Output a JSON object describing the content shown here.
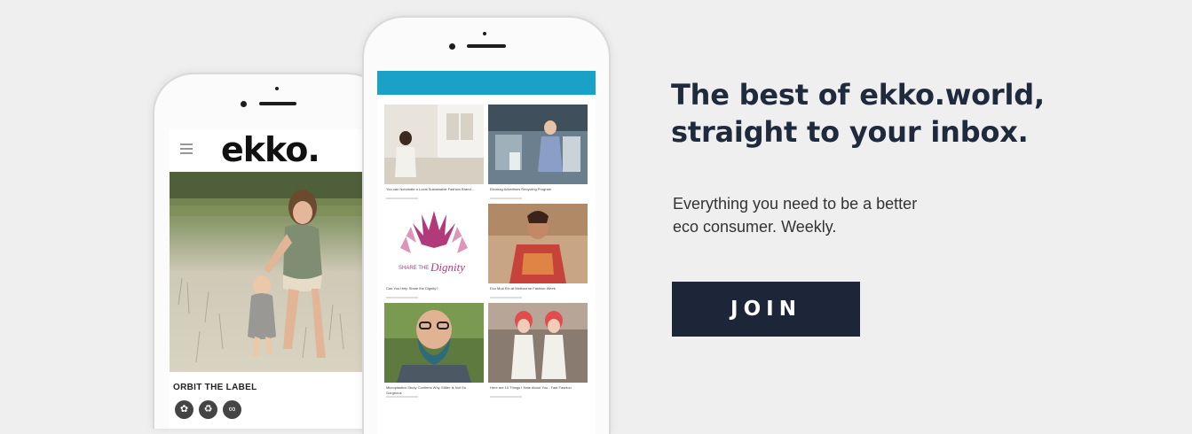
{
  "promo": {
    "headline_line1": "The best of ekko.world,",
    "headline_line2": "straight to your inbox.",
    "subline_line1": "Everything you need to be a better",
    "subline_line2": "eco consumer. Weekly.",
    "join_label": "JOIN"
  },
  "left_phone": {
    "logo": "ekko.",
    "brand_label": "ORBIT THE LABEL",
    "icons": [
      "leaf-icon",
      "recycle-icon",
      "infinity-icon"
    ]
  },
  "right_phone": {
    "cards": [
      {
        "caption": "You can Nominate a Local Sustainable Fashion Brand..."
      },
      {
        "caption": "Ekomag Advertises Recycling Program"
      },
      {
        "caption": "Can You Help Share the Dignity?",
        "art_text": "Dignity",
        "art_prefix": "SHARE THE"
      },
      {
        "caption": "Eco Mud Ein at Melbourne Fashion Week"
      },
      {
        "caption": "Microplastics Study Confirms Why Glitter Is Not So Gorgeous"
      },
      {
        "caption": "Here are 10 Things I Hate About You - Fast Fashion"
      }
    ]
  },
  "colors": {
    "background": "#efeff0",
    "navy": "#1d2638",
    "accent_blue": "#1aa1c8"
  }
}
